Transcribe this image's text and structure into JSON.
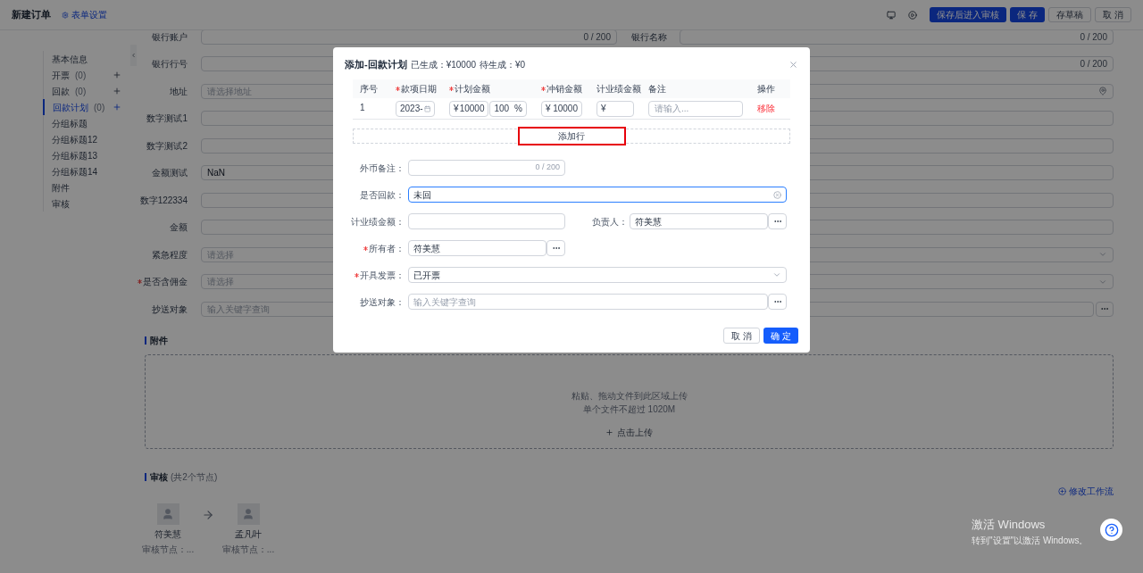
{
  "header": {
    "title": "新建订单",
    "settings_link": "表单设置",
    "actions": [
      {
        "label": "保存后进入审核",
        "primary": true
      },
      {
        "label": "保 存",
        "primary": true
      },
      {
        "label": "存草稿",
        "primary": false
      },
      {
        "label": "取 消",
        "primary": false
      }
    ]
  },
  "nav": {
    "items": [
      {
        "label": "基本信息",
        "addable": false,
        "selected": false
      },
      {
        "label": "开票",
        "count": "(0)",
        "addable": true,
        "selected": false
      },
      {
        "label": "回款",
        "count": "(0)",
        "addable": true,
        "selected": false
      },
      {
        "label": "回款计划",
        "count": "(0)",
        "addable": true,
        "selected": true
      },
      {
        "label": "分组标题",
        "addable": false,
        "selected": false
      },
      {
        "label": "分组标题12",
        "addable": false,
        "selected": false
      },
      {
        "label": "分组标题13",
        "addable": false,
        "selected": false
      },
      {
        "label": "分组标题14",
        "addable": false,
        "selected": false
      },
      {
        "label": "附件",
        "addable": false,
        "selected": false
      },
      {
        "label": "审核",
        "addable": false,
        "selected": false
      }
    ]
  },
  "form": {
    "rows": [
      {
        "label": "银行账户",
        "kind": "text",
        "required": false,
        "counter": "0 / 200",
        "extra": {
          "label": "银行名称",
          "counter": "0 / 200"
        }
      },
      {
        "label": "银行行号",
        "kind": "text",
        "required": false,
        "extra": {
          "counter": "0 / 200"
        }
      },
      {
        "label": "地址",
        "kind": "address",
        "required": false,
        "placeholder": "请选择地址"
      },
      {
        "label": "数字测试1",
        "kind": "text",
        "required": false
      },
      {
        "label": "数字测试2",
        "kind": "text",
        "required": false
      },
      {
        "label": "金额测试",
        "kind": "text",
        "required": false,
        "value": "NaN"
      },
      {
        "label": "数字122334",
        "kind": "text",
        "required": false
      },
      {
        "label": "金额",
        "kind": "text",
        "required": false
      },
      {
        "label": "紧急程度",
        "kind": "select",
        "required": false,
        "placeholder": "请选择"
      },
      {
        "label": "是否含佣金",
        "kind": "select",
        "required": true,
        "placeholder": "请选择"
      },
      {
        "label": "抄送对象",
        "kind": "picker",
        "required": false,
        "placeholder": "输入关键字查询"
      }
    ]
  },
  "attachments": {
    "title": "附件",
    "hint": "粘贴、拖动文件到此区域上传",
    "limit": "单个文件不超过 1020M",
    "button": "点击上传"
  },
  "review": {
    "title": "审核",
    "node_count": "(共2个节点)",
    "edit_link": "修改工作流",
    "approvers": [
      {
        "name": "符美慧",
        "node": "审核节点：..."
      },
      {
        "name": "孟凡叶",
        "node": "审核节点：..."
      }
    ]
  },
  "modal": {
    "title": "添加-回款计划",
    "stats": [
      "已生成：¥10000",
      "待生成：¥0"
    ],
    "table": {
      "columns": [
        {
          "label": "序号",
          "required": false
        },
        {
          "label": "款项日期",
          "required": true
        },
        {
          "label": "计划金额",
          "required": true
        },
        {
          "label": "冲销金额",
          "required": true
        },
        {
          "label": "计业绩金额",
          "required": false
        },
        {
          "label": "备注",
          "required": false
        },
        {
          "label": "操作",
          "required": false
        }
      ],
      "rows": [
        {
          "index": "1",
          "date": "2023-",
          "plan": {
            "currency": "¥",
            "value": "10000"
          },
          "plan_percent": {
            "value": "100",
            "unit": "%"
          },
          "offset": {
            "currency": "¥",
            "value": "10000"
          },
          "performance": {
            "currency": "¥"
          },
          "remark_placeholder": "请输入...",
          "action": "移除"
        }
      ]
    },
    "add_row": "添加行",
    "form": {
      "rows": [
        {
          "fields": [
            {
              "label": "外币备注：",
              "kind": "text",
              "wide": false,
              "required": false,
              "counter": "0 / 200"
            }
          ]
        },
        {
          "fields": [
            {
              "label": "是否回款：",
              "kind": "text",
              "wide": true,
              "required": false,
              "value": "未回",
              "focused": true,
              "clearable": true
            }
          ]
        },
        {
          "fields": [
            {
              "label": "计业绩金额：",
              "kind": "text",
              "wide": false,
              "required": false
            },
            {
              "label": "负责人：",
              "kind": "picker",
              "wide": false,
              "required": false,
              "value": "符美慧"
            }
          ]
        },
        {
          "fields": [
            {
              "label": "所有者：",
              "kind": "picker",
              "wide": false,
              "required": true,
              "value": "符美慧"
            }
          ]
        },
        {
          "fields": [
            {
              "label": "开具发票：",
              "kind": "select",
              "wide": true,
              "required": true,
              "value": "已开票"
            }
          ]
        },
        {
          "fields": [
            {
              "label": "抄送对象：",
              "kind": "picker",
              "wide": true,
              "required": false,
              "placeholder": "输入关键字查询"
            }
          ]
        }
      ]
    },
    "buttons": [
      {
        "label": "取 消",
        "primary": false
      },
      {
        "label": "确 定",
        "primary": true
      }
    ]
  },
  "os_notice": {
    "title": "激活 Windows",
    "subtitle": "转到\"设置\"以激活 Windows。"
  }
}
